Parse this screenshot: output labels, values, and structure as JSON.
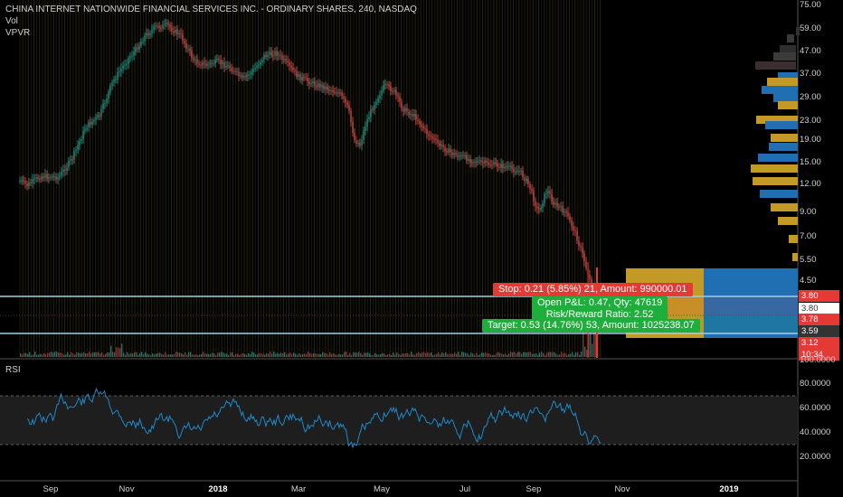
{
  "legend": {
    "title": "CHINA INTERNET NATIONWIDE FINANCIAL SERVICES INC. - ORDINARY SHARES, 240, NASDAQ",
    "vol": "Vol",
    "vpvr": "VPVR"
  },
  "rsi_label": "RSI",
  "price_axis": [
    "75.00",
    "59.00",
    "47.00",
    "37.00",
    "29.00",
    "23.00",
    "19.00",
    "15.00",
    "12.00",
    "9.00",
    "7.00",
    "5.50",
    "4.50"
  ],
  "price_tags": {
    "stop_price": "3.80",
    "current": "3.80",
    "entry": "3.78",
    "last": "3.59",
    "target_price": "3.12",
    "time": "10:34",
    "vol_max": "100.0000"
  },
  "rsi_axis": [
    "80.0000",
    "60.0000",
    "40.0000",
    "20.0000"
  ],
  "time_axis": [
    {
      "label": "Sep",
      "bold": false
    },
    {
      "label": "Nov",
      "bold": false
    },
    {
      "label": "2018",
      "bold": true
    },
    {
      "label": "Mar",
      "bold": false
    },
    {
      "label": "May",
      "bold": false
    },
    {
      "label": "Jul",
      "bold": false
    },
    {
      "label": "Sep",
      "bold": false
    },
    {
      "label": "Nov",
      "bold": false
    },
    {
      "label": "2019",
      "bold": true
    }
  ],
  "trade": {
    "stop_text": "Stop: 0.21 (5.85%) 21, Amount: 990000.01",
    "pnl_line1": "Open P&L: 0.47, Qty: 47619",
    "pnl_line2": "Risk/Reward Ratio: 2.52",
    "target_text": "Target: 0.53 (14.76%) 53, Amount: 1025238.07"
  },
  "colors": {
    "up": "#26a69a",
    "down": "#ef5350",
    "vpvr_blue": "#1f6fb2",
    "vpvr_gold": "#c49a26",
    "stop": "#e53935",
    "target": "#1fae3c",
    "rsi": "#1e88c8",
    "price_line": "#9fd0e0"
  }
}
